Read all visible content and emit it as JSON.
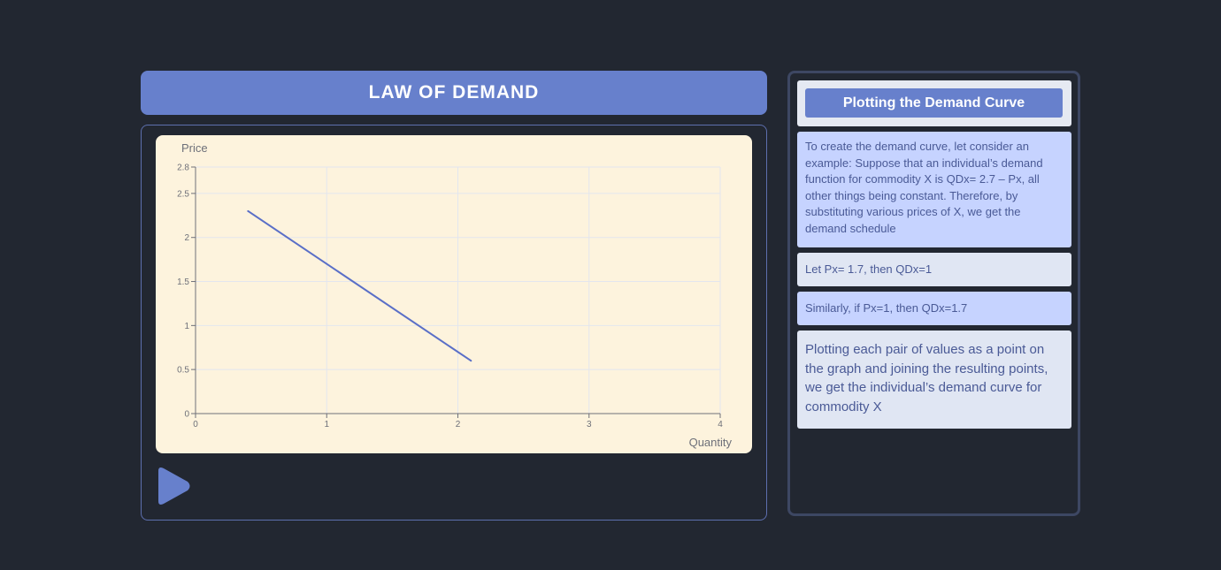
{
  "header": {
    "title": "LAW OF DEMAND"
  },
  "controls": {
    "play_icon": "play-icon"
  },
  "side": {
    "title": "Plotting the Demand Curve",
    "notes": [
      "To create the demand curve, let consider an example: Suppose that an individual’s demand function for commodity X is QDx= 2.7 – Px, all other things being constant. Therefore, by substituting various prices of X, we get the demand schedule",
      "Let Px= 1.7, then QDx=1",
      "Similarly, if Px=1, then QDx=1.7",
      "Plotting each pair of values as a point on the graph and joining the resulting points, we get the individual’s demand curve for commodity X"
    ]
  },
  "colors": {
    "accent": "#6780cc",
    "line": "#5a6fc7",
    "chart_bg": "#fdf3dd",
    "page_bg": "#222731"
  },
  "chart_data": {
    "type": "line",
    "title": "",
    "xlabel": "Quantity",
    "ylabel": "Price",
    "xlim": [
      0,
      4
    ],
    "ylim": [
      0,
      2.8
    ],
    "x_ticks": [
      "0",
      "1",
      "2",
      "3",
      "4"
    ],
    "y_ticks": [
      "0",
      "0.5",
      "1",
      "1.5",
      "2",
      "2.5",
      "2.8"
    ],
    "grid": true,
    "series": [
      {
        "x": [
          0.4,
          2.1
        ],
        "y": [
          2.3,
          0.6
        ]
      }
    ]
  }
}
